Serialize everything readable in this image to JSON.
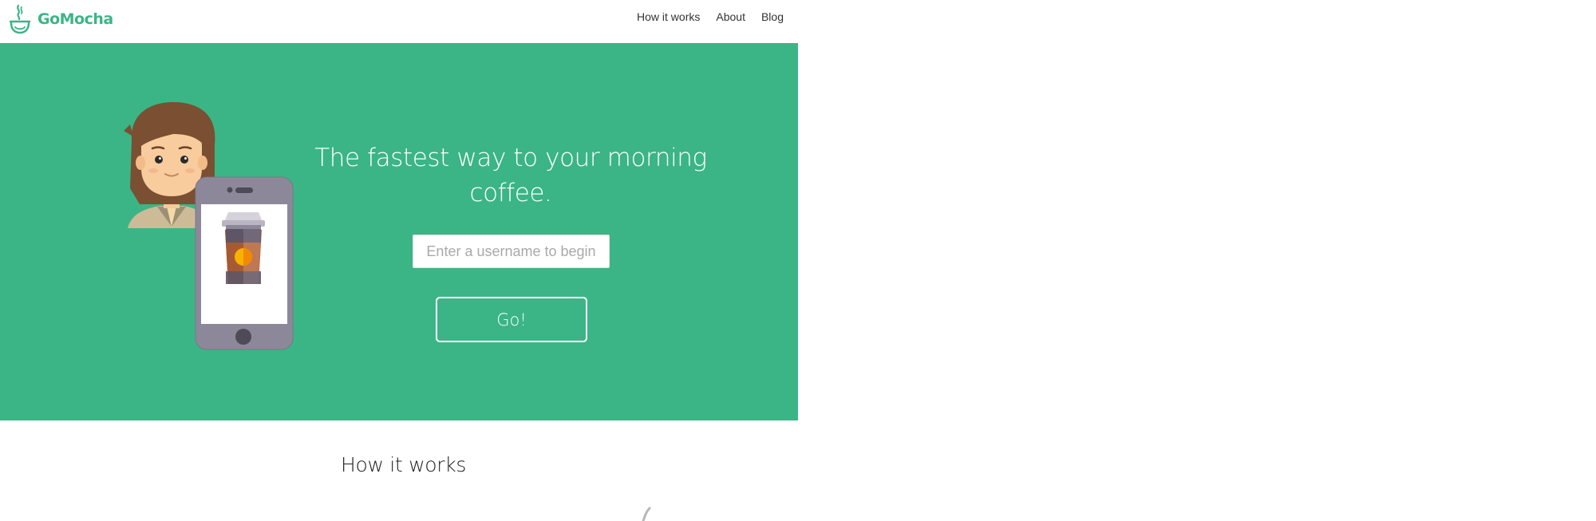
{
  "brand": {
    "name": "GoMocha",
    "icon": "coffee-cup-steam-icon",
    "color": "#3bb586"
  },
  "nav": {
    "items": [
      {
        "label": "How it works"
      },
      {
        "label": "About"
      },
      {
        "label": "Blog"
      }
    ]
  },
  "hero": {
    "background": "#3bb586",
    "headline": "The fastest way to your morning coffee.",
    "username_input": {
      "placeholder": "Enter a username to begin",
      "value": ""
    },
    "go_button_label": "Go!",
    "illustration": {
      "person": "person-avatar-icon",
      "phone": "smartphone-icon",
      "cup": "coffee-cup-icon"
    }
  },
  "section": {
    "title": "How it works"
  }
}
